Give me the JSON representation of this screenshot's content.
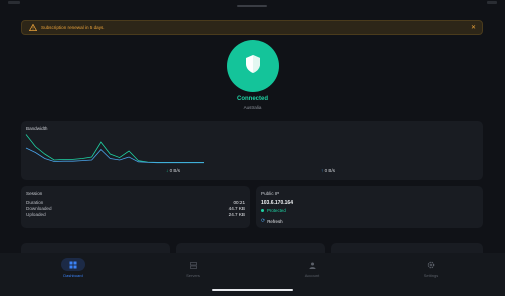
{
  "alert": {
    "message": "Subscription renewal in 5 days.",
    "close_glyph": "✕",
    "icon": "warning-icon"
  },
  "connection": {
    "status": "Connected",
    "location": "Australia",
    "icon": "shield-icon",
    "color": "#14c49a"
  },
  "bandwidth": {
    "title": "Bandwidth",
    "download_rate": "0 B/s",
    "upload_rate": "0 B/s",
    "download_arrow": "↓",
    "upload_arrow": "↑",
    "download_color": "#1fd3a4",
    "upload_color": "#4aa3e8"
  },
  "chart_data": {
    "type": "line",
    "title": "Bandwidth",
    "series": [
      {
        "values": [
          0.95,
          0.55,
          0.3,
          0.1,
          0.12,
          0.12,
          0.15,
          0.2,
          0.7,
          0.3,
          0.18,
          0.4,
          0.08,
          0.03,
          0.02,
          0.02,
          0.02,
          0.02,
          0.02,
          0.02
        ],
        "color": "#1fd3a4"
      },
      {
        "values": [
          0.5,
          0.35,
          0.15,
          0.05,
          0.06,
          0.06,
          0.08,
          0.1,
          0.45,
          0.15,
          0.1,
          0.2,
          0.04,
          0.02,
          0.01,
          0.01,
          0.01,
          0.01,
          0.01,
          0.01
        ],
        "color": "#4aa3e8"
      }
    ],
    "grid": false,
    "legend": "none"
  },
  "session": {
    "title": "Session",
    "rows": [
      {
        "label": "Duration",
        "value": "00:21"
      },
      {
        "label": "Downloaded",
        "value": "44.7 KB"
      },
      {
        "label": "Uploaded",
        "value": "24.7 KB"
      }
    ]
  },
  "public_ip": {
    "title": "Public IP",
    "ip": "103.6.170.164",
    "status": "Protected",
    "refresh_label": "Refresh"
  },
  "nav": {
    "items": [
      {
        "label": "Dashboard",
        "icon": "grid-icon",
        "active": true
      },
      {
        "label": "Servers",
        "icon": "servers-icon",
        "active": false
      },
      {
        "label": "Account",
        "icon": "person-icon",
        "active": false
      },
      {
        "label": "Settings",
        "icon": "gear-icon",
        "active": false
      }
    ],
    "active_color": "#3b82f6"
  }
}
